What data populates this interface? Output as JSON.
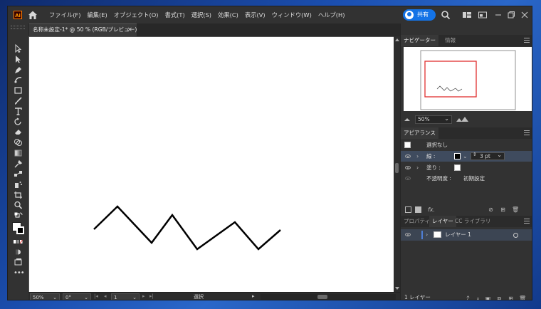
{
  "app": {
    "logo_text": "Ai",
    "menus": [
      "ファイル(F)",
      "編集(E)",
      "オブジェクト(O)",
      "書式(T)",
      "選択(S)",
      "効果(C)",
      "表示(V)",
      "ウィンドウ(W)",
      "ヘルプ(H)"
    ],
    "share_label": "共有"
  },
  "document": {
    "tab_title": "名称未設定-1* @ 50 % (RGB/プレビュー)",
    "close_glyph": "×"
  },
  "status_bar": {
    "zoom": "50%",
    "rotation": "0°",
    "artboard_number": "1",
    "tool_status": "選択"
  },
  "navigator_panel": {
    "tabs": [
      "ナビゲーター",
      "情報"
    ],
    "zoom_value": "50%",
    "proxy_color": "#e03030"
  },
  "appearance_panel": {
    "tab_title": "アピアランス",
    "header_label": "選択なし",
    "stroke_label": "線 :",
    "stroke_weight": "3 pt",
    "fill_label": "塗り :",
    "opacity_label": "不透明度 :",
    "opacity_value": "初期設定",
    "fx_label": "fx."
  },
  "layers_panel": {
    "tabs": [
      "プロパティ",
      "レイヤー",
      "CC ライブラリ"
    ],
    "layer_name": "レイヤー 1",
    "footer_count": "1 レイヤー",
    "layer_color": "#4f7fd6"
  },
  "drawing": {
    "stroke_color": "#000000"
  }
}
